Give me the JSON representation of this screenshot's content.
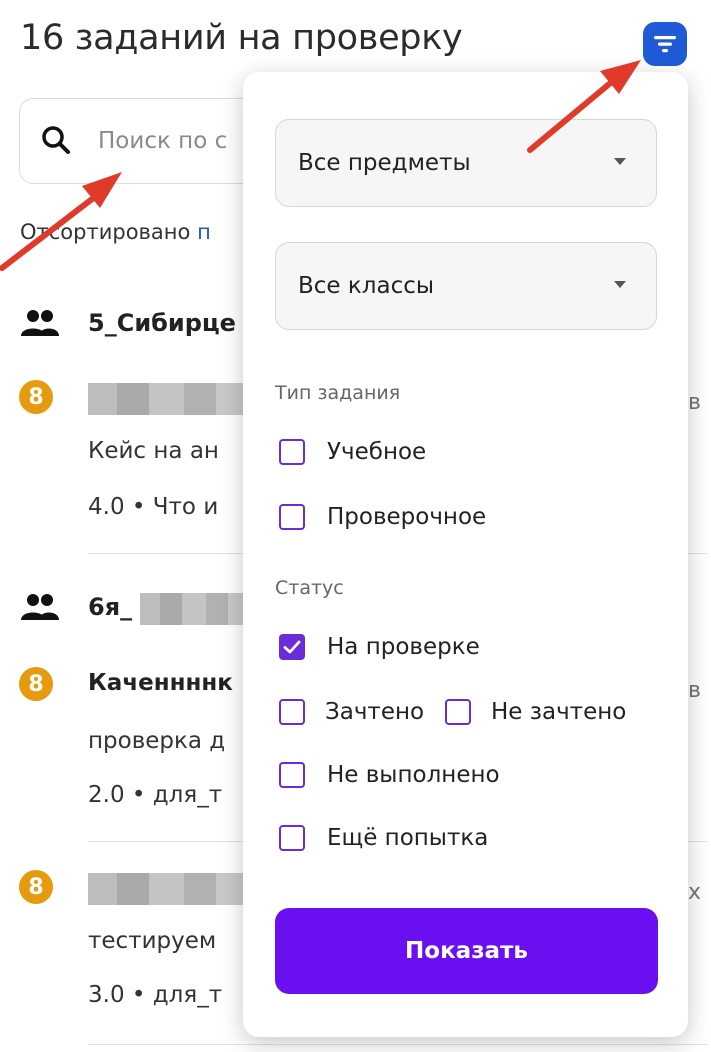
{
  "header": {
    "title": "16 заданий на проверку"
  },
  "search": {
    "placeholder": "Поиск по с"
  },
  "sort": {
    "prefix": "Отсортировано",
    "link": "п"
  },
  "groups": [
    {
      "name": "5_Сибирце",
      "icon": "people-icon"
    },
    {
      "name": "6я_",
      "icon": "people-icon"
    }
  ],
  "tasks": [
    {
      "status_icon": "hourglass-icon",
      "badge": "8",
      "line1": "Кейс на ан",
      "line2": "4.0 • Что и",
      "right_char": "в"
    },
    {
      "status_icon": "hourglass-icon",
      "badge": "8",
      "title": "Каченнннк",
      "line1": "проверка д",
      "line2": "2.0 • для_т",
      "right_char": "в"
    },
    {
      "status_icon": "hourglass-icon",
      "badge": "8",
      "line1": "тестируем",
      "line2": "3.0 • для_т",
      "right_char": "х"
    }
  ],
  "filter_panel": {
    "subject_select": "Все предметы",
    "class_select": "Все классы",
    "task_type_title": "Тип задания",
    "task_types": [
      {
        "label": "Учебное",
        "checked": false
      },
      {
        "label": "Проверочное",
        "checked": false
      }
    ],
    "status_title": "Статус",
    "statuses": [
      {
        "label": "На проверке",
        "checked": true
      },
      {
        "label": "Зачтено",
        "checked": false
      },
      {
        "label": "Не зачтено",
        "checked": false
      },
      {
        "label": "Не выполнено",
        "checked": false
      },
      {
        "label": "Ещё попытка",
        "checked": false
      }
    ],
    "show_button": "Показать"
  },
  "colors": {
    "accent_blue": "#1f5bd6",
    "accent_purple": "#6a10f0",
    "checkbox_purple": "#6a2bd9",
    "status_orange": "#e69a0e",
    "annotation_red": "#e03a2a"
  }
}
